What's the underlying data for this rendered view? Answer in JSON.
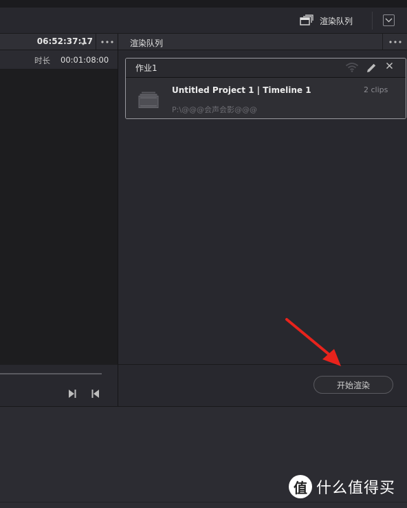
{
  "toolbar": {
    "render_queue_label": "渲染队列"
  },
  "viewer": {
    "timecode": "06:52:37:17",
    "duration_label": "时长",
    "duration_value": "00:01:08:00"
  },
  "render_queue": {
    "title": "渲染队列",
    "jobs": [
      {
        "name": "作业1",
        "title": "Untitled Project 1 | Timeline 1",
        "path": "P:\\@@@会声会影@@@",
        "clips": "2 clips"
      }
    ],
    "start_button_label": "开始渲染"
  },
  "watermark": {
    "logo_char": "值",
    "text": "什么值得买"
  },
  "colors": {
    "annotation_arrow": "#e8231c",
    "background": "#28282e",
    "viewer": "#1d1d1f"
  }
}
